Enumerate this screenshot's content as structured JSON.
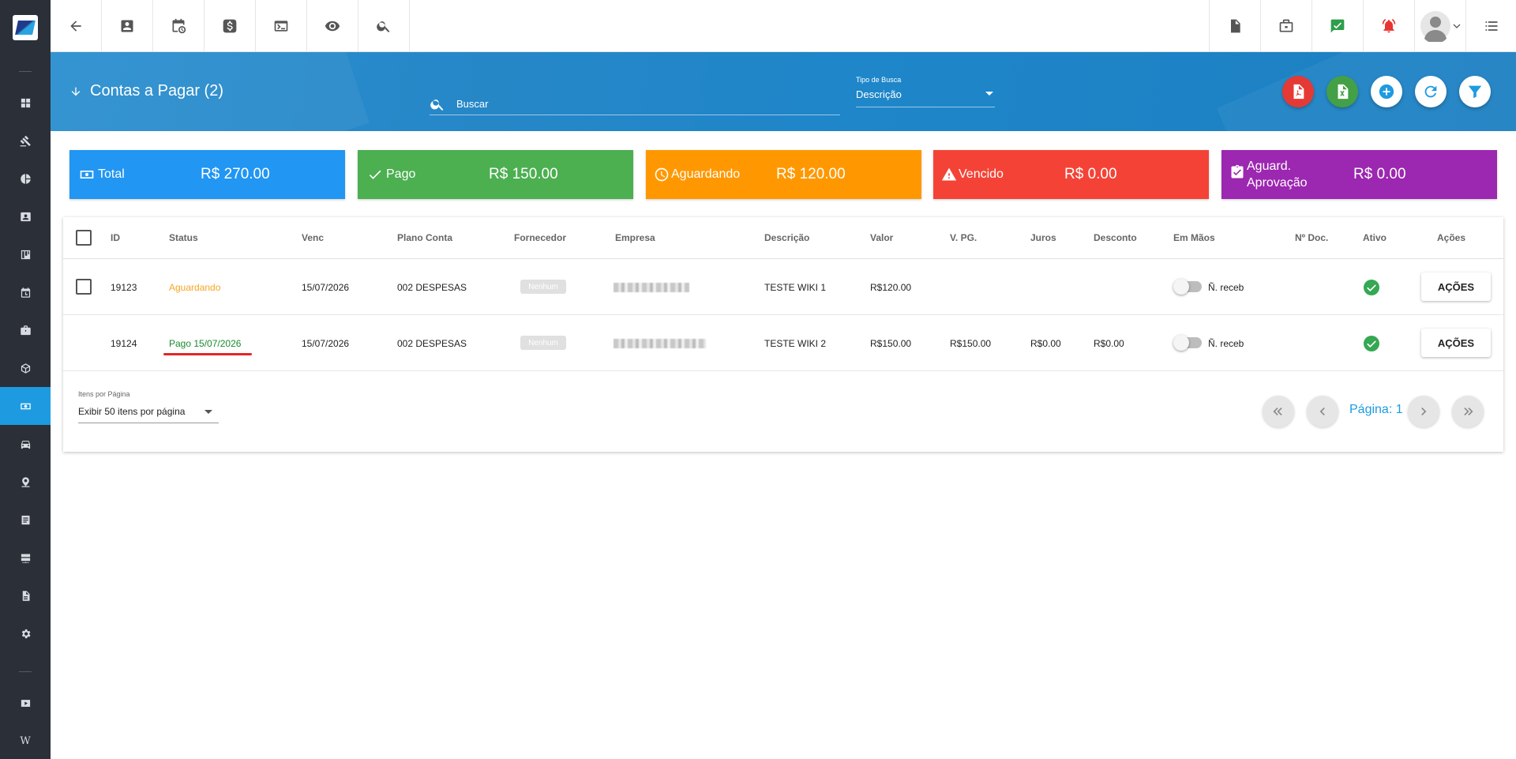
{
  "sidebar": {
    "items": [
      {
        "icon": "dashboard-icon"
      },
      {
        "icon": "gavel-icon"
      },
      {
        "icon": "pie-chart-icon"
      },
      {
        "icon": "contact-card-icon"
      },
      {
        "icon": "kanban-icon"
      },
      {
        "icon": "schedule-icon"
      },
      {
        "icon": "business-icon"
      },
      {
        "icon": "package-icon"
      },
      {
        "icon": "money-icon",
        "active": true
      },
      {
        "icon": "car-icon"
      },
      {
        "icon": "location-icon"
      },
      {
        "icon": "document-list-icon"
      },
      {
        "icon": "server-icon"
      },
      {
        "icon": "file-icon"
      },
      {
        "icon": "settings-icon"
      },
      {
        "icon": "video-icon"
      },
      {
        "icon": "wiki-icon",
        "text": "W"
      }
    ]
  },
  "topbar": {
    "left_icons": [
      "back-arrow-icon",
      "contact-icon",
      "alarm-clock-icon",
      "dollar-icon",
      "terminal-icon",
      "eye-icon",
      "search-icon"
    ],
    "right_icons": [
      "pdf-file-icon",
      "business-case-icon",
      "chat-check-icon",
      "alarm-bell-icon",
      "user-avatar-icon",
      "list-menu-icon"
    ]
  },
  "header": {
    "title": "Contas a Pagar (2)",
    "search_placeholder": "Buscar",
    "tipo_label": "Tipo de Busca",
    "tipo_value": "Descrição"
  },
  "colors": {
    "header_blue": "#2687c7",
    "total": "#2196f3",
    "pago": "#4caf50",
    "aguardando": "#ff9800",
    "vencido": "#f44336",
    "aprovacao": "#9c27b0",
    "accent": "#1e9be0"
  },
  "cards": [
    {
      "label": "Total",
      "amount": "R$ 270.00",
      "icon": "money-bill-icon"
    },
    {
      "label": "Pago",
      "amount": "R$ 150.00",
      "icon": "check-icon"
    },
    {
      "label": "Aguardando",
      "amount": "R$ 120.00",
      "icon": "clock-icon"
    },
    {
      "label": "Vencido",
      "amount": "R$ 0.00",
      "icon": "warning-icon"
    },
    {
      "label": "Aguard. Aprovação",
      "label_line1": "Aguard.",
      "label_line2": "Aprovação",
      "amount": "R$ 0.00",
      "icon": "clipboard-check-icon"
    }
  ],
  "table": {
    "headers": [
      "ID",
      "Status",
      "Venc",
      "Plano Conta",
      "Fornecedor",
      "Empresa",
      "Descrição",
      "Valor",
      "V. PG.",
      "Juros",
      "Desconto",
      "Em Mãos",
      "Nº Doc.",
      "Ativo",
      "Ações"
    ],
    "rows": [
      {
        "id": "19123",
        "status": "Aguardando",
        "venc": "15/07/2026",
        "plano": "002 DESPESAS",
        "fornecedor": "Nenhum",
        "descricao": "TESTE WIKI 1",
        "valor": "R$120.00",
        "vpg": "",
        "juros": "",
        "desconto": "",
        "em_maos": "Ñ. receb",
        "acoes": "AÇÕES"
      },
      {
        "id": "19124",
        "status": "Pago 15/07/2026",
        "venc": "15/07/2026",
        "plano": "002 DESPESAS",
        "fornecedor": "Nenhum",
        "descricao": "TESTE WIKI 2",
        "valor": "R$150.00",
        "vpg": "R$150.00",
        "juros": "R$0.00",
        "desconto": "R$0.00",
        "em_maos": "Ñ. receb",
        "acoes": "AÇÕES"
      }
    ]
  },
  "pagination": {
    "per_page_label": "Itens por Página",
    "per_page_value": "Exibir 50 itens por página",
    "page_text": "Página: 1"
  }
}
